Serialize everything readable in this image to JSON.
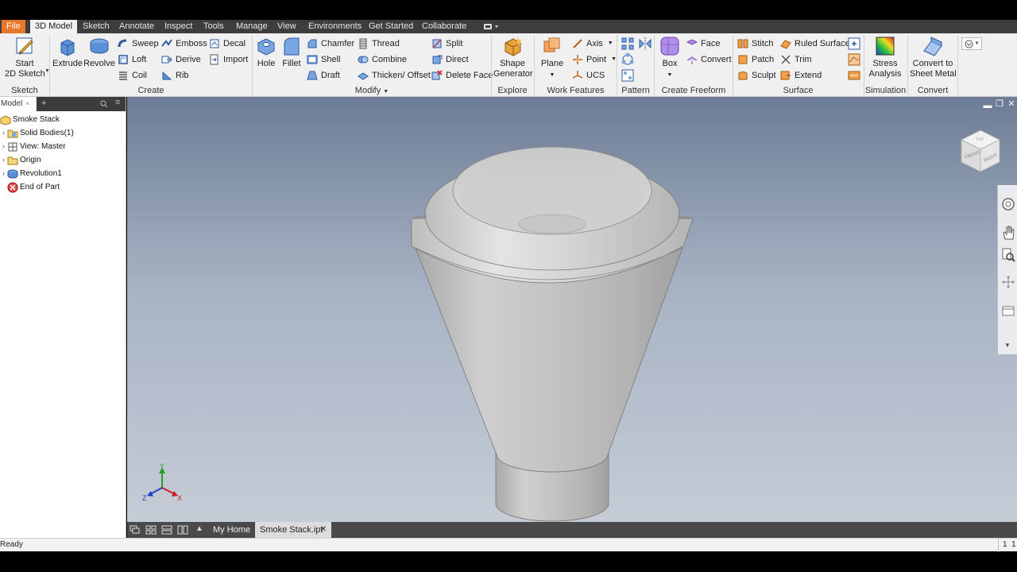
{
  "menubar": {
    "tabs": [
      "File",
      "3D Model",
      "Sketch",
      "Annotate",
      "Inspect",
      "Tools",
      "Manage",
      "View",
      "Environments",
      "Get Started",
      "Collaborate"
    ],
    "active_tab": "3D Model"
  },
  "ribbon": {
    "sketch": {
      "start_label": "Start 2D Sketch",
      "start_line1": "Start",
      "start_line2": "2D Sketch",
      "group": "Sketch"
    },
    "create": {
      "group": "Create",
      "extrude": "Extrude",
      "revolve": "Revolve",
      "sweep": "Sweep",
      "loft": "Loft",
      "coil": "Coil",
      "emboss": "Emboss",
      "derive": "Derive",
      "rib": "Rib",
      "decal": "Decal",
      "import": "Import"
    },
    "modify": {
      "group": "Modify",
      "hole": "Hole",
      "fillet": "Fillet",
      "chamfer": "Chamfer",
      "shell": "Shell",
      "draft": "Draft",
      "thread": "Thread",
      "combine": "Combine",
      "thicken": "Thicken/ Offset",
      "split": "Split",
      "direct": "Direct",
      "delete_face": "Delete Face"
    },
    "explore": {
      "group": "Explore",
      "line1": "Shape",
      "line2": "Generator"
    },
    "work_features": {
      "group": "Work Features",
      "plane": "Plane",
      "axis": "Axis",
      "point": "Point",
      "ucs": "UCS"
    },
    "pattern": {
      "group": "Pattern"
    },
    "freeform": {
      "group": "Create Freeform",
      "box": "Box",
      "face": "Face",
      "convert": "Convert"
    },
    "surface": {
      "group": "Surface",
      "stitch": "Stitch",
      "patch": "Patch",
      "sculpt": "Sculpt",
      "ruled": "Ruled Surface",
      "trim": "Trim",
      "extend": "Extend"
    },
    "simulation": {
      "group": "Simulation",
      "line1": "Stress",
      "line2": "Analysis"
    },
    "convert": {
      "group": "Convert",
      "line1": "Convert to",
      "line2": "Sheet Metal"
    }
  },
  "browser": {
    "tab": "Model",
    "items": [
      {
        "label": "Smoke Stack"
      },
      {
        "label": "Solid Bodies(1)"
      },
      {
        "label": "View: Master"
      },
      {
        "label": "Origin"
      },
      {
        "label": "Revolution1"
      },
      {
        "label": "End of Part"
      }
    ]
  },
  "viewcube": {
    "front": "FRONT",
    "right": "RIGHT",
    "top": "TOP"
  },
  "triad": {
    "x": "X",
    "y": "Y",
    "z": "Z"
  },
  "doc_tabs": {
    "home": "My Home",
    "active": "Smoke Stack.ipt",
    "close": "✕"
  },
  "status": {
    "left": "Ready",
    "right1": "1",
    "right2": "1"
  },
  "colors": {
    "accent_file": "#e8762b",
    "menubar": "#3d3d3d",
    "ribbon": "#f0f0f0",
    "viewport_top": "#6d7c95",
    "viewport_bottom": "#c5ccd6"
  }
}
